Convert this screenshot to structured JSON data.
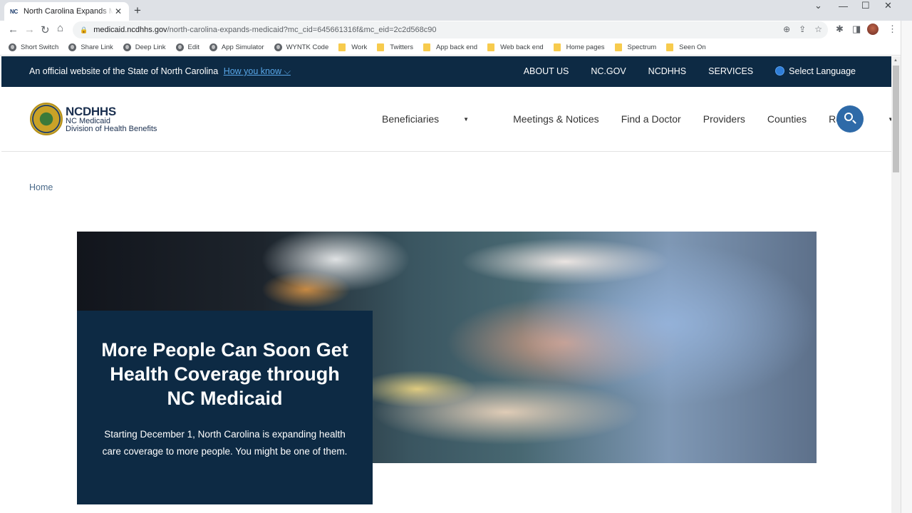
{
  "browser": {
    "tab": {
      "favicon": "NC",
      "title": "North Carolina Expands Medicaid",
      "close": "✕"
    },
    "new_tab": "+",
    "window_controls": {
      "dropdown": "⌄",
      "minimize": "—",
      "maximize": "☐",
      "close": "✕"
    },
    "nav": {
      "back": "←",
      "forward": "→",
      "reload": "↻",
      "home": "⌂"
    },
    "url": {
      "domain": "medicaid.ncdhhs.gov",
      "path": "/north-carolina-expands-medicaid?mc_cid=645661316f&mc_eid=2c2d568c90"
    },
    "omnibox_icons": [
      "zoom-icon",
      "share-icon",
      "star-icon"
    ],
    "toolbar_icons": [
      "extensions-icon",
      "side-panel-icon",
      "profile-avatar",
      "menu-icon"
    ],
    "bookmarks": [
      {
        "label": "Short Switch",
        "type": "link"
      },
      {
        "label": "Share Link",
        "type": "link"
      },
      {
        "label": "Deep Link",
        "type": "link"
      },
      {
        "label": "Edit",
        "type": "link"
      },
      {
        "label": "App Simulator",
        "type": "link"
      },
      {
        "label": "WYNTK Code",
        "type": "link"
      },
      {
        "label": "Work",
        "type": "folder"
      },
      {
        "label": "Twitters",
        "type": "folder"
      },
      {
        "label": "App back end",
        "type": "folder"
      },
      {
        "label": "Web back end",
        "type": "folder"
      },
      {
        "label": "Home pages",
        "type": "folder"
      },
      {
        "label": "Spectrum",
        "type": "folder"
      },
      {
        "label": "Seen On",
        "type": "folder"
      }
    ]
  },
  "govbar": {
    "official_text": "An official website of the State of North Carolina",
    "how_you_know": "How you know ⌵",
    "links": [
      "ABOUT US",
      "NC.GOV",
      "NCDHHS",
      "SERVICES"
    ],
    "language": "Select Language"
  },
  "header": {
    "brand_title": "NCDHHS",
    "brand_line1": "NC Medicaid",
    "brand_line2": "Division of Health Benefits",
    "nav": [
      {
        "label": "Beneficiaries",
        "dropdown": true
      },
      {
        "label": "Meetings & Notices",
        "dropdown": false
      },
      {
        "label": "Find a Doctor",
        "dropdown": false
      },
      {
        "label": "Providers",
        "dropdown": false
      },
      {
        "label": "Counties",
        "dropdown": false
      },
      {
        "label": "Reports",
        "dropdown": true
      }
    ],
    "caret": "▼"
  },
  "breadcrumb": {
    "home": "Home"
  },
  "hero": {
    "image_alt": "Chef in a kitchen plating food",
    "title": "More People Can Soon Get Health Coverage through NC Medicaid",
    "body": "Starting December 1, North Carolina is expanding health care coverage to more people. You might be one of them."
  },
  "colors": {
    "navy": "#0d2a44",
    "link_blue": "#58a6e7",
    "search_blue": "#2e6aa8"
  }
}
